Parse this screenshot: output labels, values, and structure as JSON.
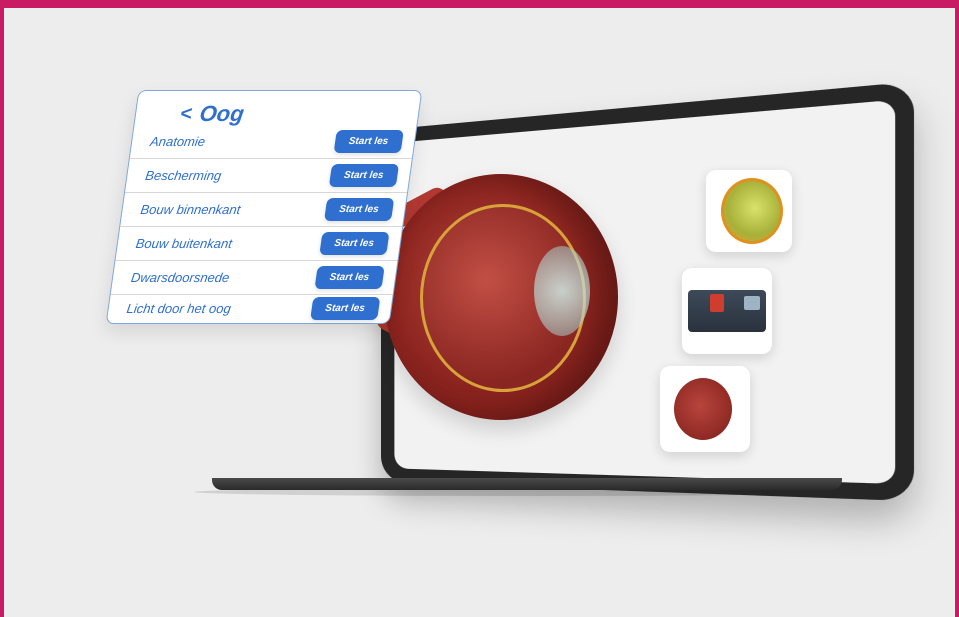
{
  "menu": {
    "title": "Oog",
    "back_icon": "chevron-left-icon",
    "items": [
      {
        "label": "Anatomie",
        "button": "Start les"
      },
      {
        "label": "Bescherming",
        "button": "Start les"
      },
      {
        "label": "Bouw binnenkant",
        "button": "Start les"
      },
      {
        "label": "Bouw buitenkant",
        "button": "Start les"
      },
      {
        "label": "Dwarsdoorsnede",
        "button": "Start les"
      },
      {
        "label": "Licht door het oog",
        "button": "Start les"
      }
    ]
  },
  "colors": {
    "accent": "#2f6fd0",
    "frame": "#c91b63",
    "background": "#ededed",
    "tablet": "#262626"
  }
}
